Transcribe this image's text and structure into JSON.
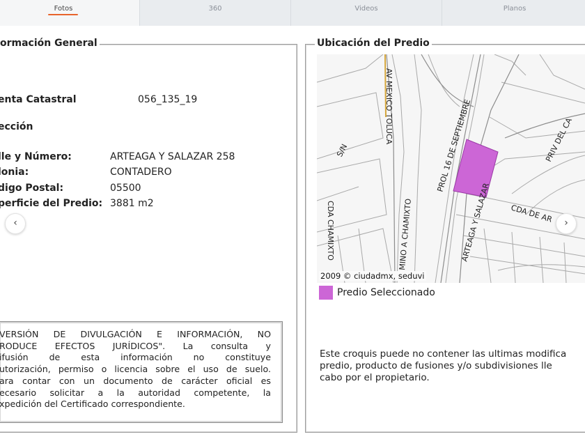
{
  "tabs": [
    {
      "label": "Fotos",
      "active": true
    },
    {
      "label": "360",
      "active": false
    },
    {
      "label": "Videos",
      "active": false
    },
    {
      "label": "Planos",
      "active": false
    }
  ],
  "info": {
    "legend": "ormación General",
    "cuenta_label": "enta Catastral",
    "cuenta_value": "056_135_19",
    "direccion_heading": "ección",
    "calle_label": "lle y Número:",
    "calle_value": "ARTEAGA Y SALAZAR 258",
    "colonia_label": "lonia:",
    "colonia_value": "CONTADERO",
    "cp_label": "digo Postal:",
    "cp_value": "05500",
    "superficie_label": "perficie del Predio:",
    "superficie_value": "3881 m2"
  },
  "disclaimer": [
    "VERSIÓN DE DIVULGACIÓN E INFORMACIÓN, NO",
    "RODUCE EFECTOS JURÍDICOS\". La consulta y",
    "ifusión de esta información no constituye",
    "utorización, permiso o licencia sobre el uso de suelo.",
    "ara contar con un documento de carácter oficial es",
    "ecesario solicitar a la autoridad competente, la",
    "xpedición del Certificado correspondiente."
  ],
  "ubicacion": {
    "legend": "Ubicación del Predio",
    "credit": "2009 © ciudadmx, seduvi",
    "legend_label": "Predio Seleccionado",
    "note": [
      "Este croquis puede no contener las ultimas modifica",
      "predio, producto de fusiones y/o subdivisiones lle",
      "cabo por el propietario."
    ]
  },
  "map_labels": {
    "av_mexico": "AV MEXICO TOLUCA",
    "sn": "S/N",
    "prol": "PROL 16 DE SEPTIEMBRE",
    "arteaga": "ARTEAGA Y SALAZAR",
    "priv": "PRIV DEL CA",
    "cda_arteaga": "CDA DE AR",
    "cda_chamixto": "CDA CHAMIXTO",
    "camino": "MINO A CHAMIXTO"
  },
  "nav": {
    "prev": "‹",
    "next": "›"
  },
  "colors": {
    "accent": "#e8642c",
    "predio": "#cc66d6"
  }
}
